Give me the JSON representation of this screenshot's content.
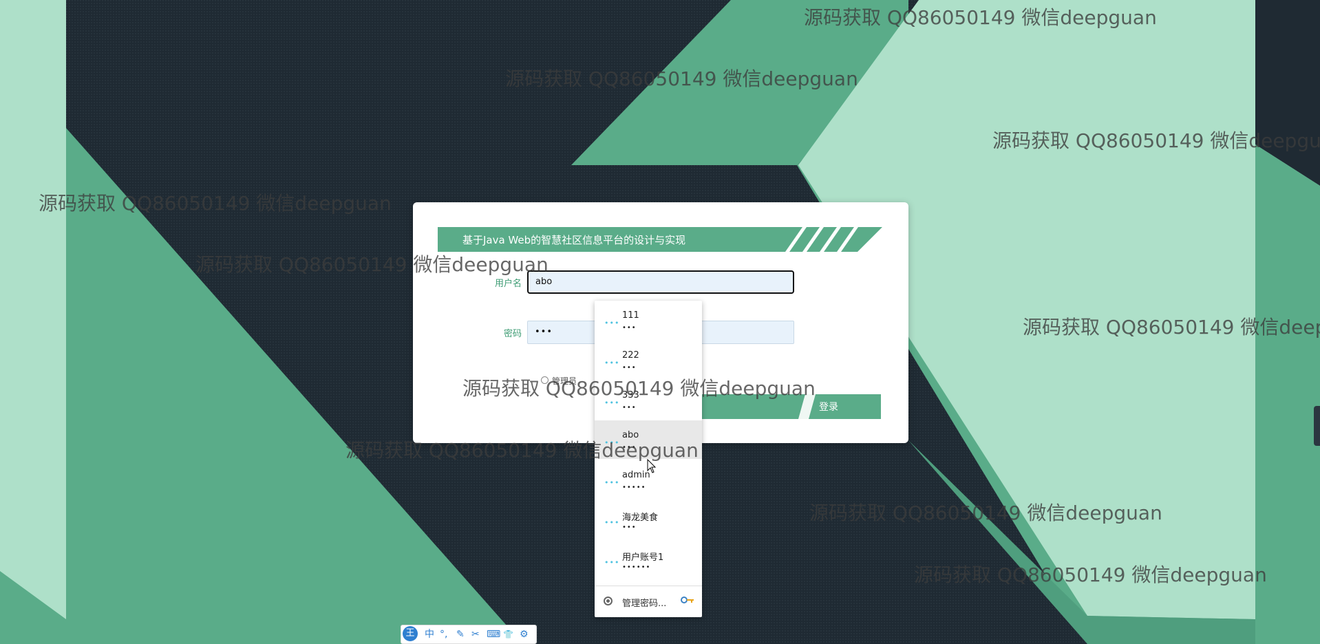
{
  "app": {
    "title": "基于Java Web的智慧社区信息平台的设计与实现"
  },
  "login": {
    "username_label": "用户名",
    "username_value": "abo",
    "password_label": "密码",
    "password_value": "•••",
    "role_option": "管理员",
    "submit_label": "登录"
  },
  "autofill": {
    "key_glyph": "•••",
    "items": [
      {
        "username": "111",
        "password": "•••"
      },
      {
        "username": "222",
        "password": "•••"
      },
      {
        "username": "333",
        "password": "•••"
      },
      {
        "username": "abo",
        "password": "•••"
      },
      {
        "username": "admin",
        "password": "•••••"
      },
      {
        "username": "海龙美食",
        "password": "•••"
      },
      {
        "username": "用户账号1",
        "password": "••••••"
      }
    ],
    "highlighted_index": 3,
    "manage_label": "管理密码...",
    "manage_icon": "chrome-icon",
    "key_icon": "key-icon"
  },
  "watermark": {
    "text": "源码获取 QQ86050149 微信deepguan"
  },
  "ime_toolbar": {
    "logo": "王",
    "buttons": [
      "中",
      "°,",
      "✎",
      "✂",
      "⌨",
      "👕",
      "⚙"
    ]
  },
  "colors": {
    "accent": "#5aac89",
    "dark_bg": "#1f2b33",
    "light_green": "#aee0c9",
    "input_bg": "#e8f2fb"
  }
}
